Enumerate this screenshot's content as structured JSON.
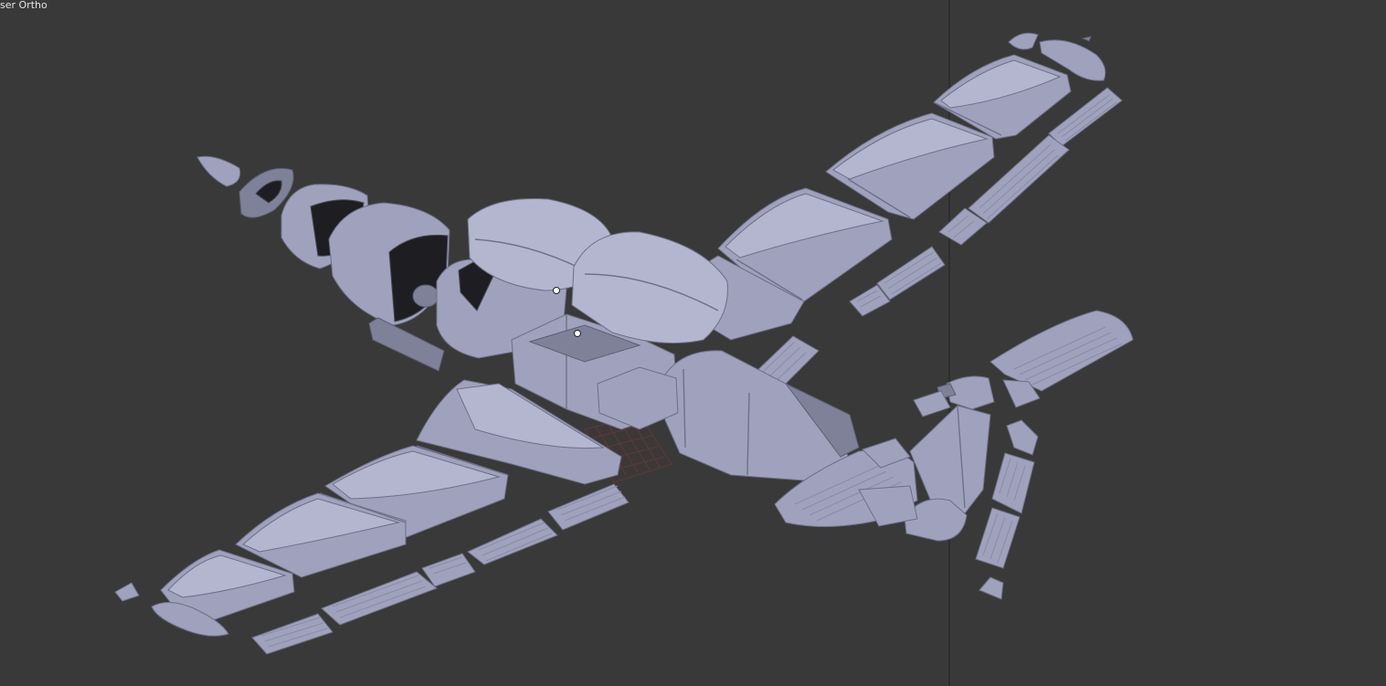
{
  "viewport": {
    "view_label": "ser Ortho",
    "background_color": "#393939",
    "mesh_color": "#a0a2bd",
    "origin_marker_color": "#f0a050",
    "vertical_guide_color": "#222226"
  }
}
